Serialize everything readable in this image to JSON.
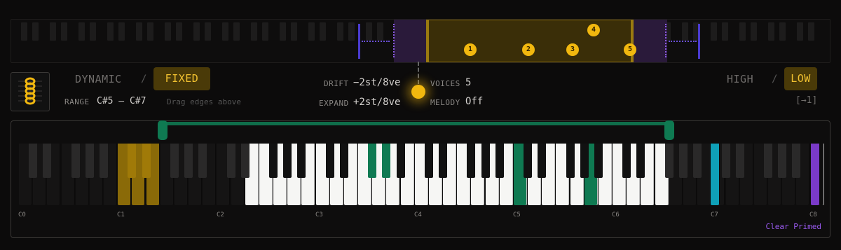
{
  "mode": {
    "dynamic": "DYNAMIC",
    "fixed": "FIXED",
    "separator": "/"
  },
  "range": {
    "label": "RANGE",
    "value": "C#5 – C#7",
    "hint": "Drag edges above"
  },
  "drift": {
    "label": "DRIFT",
    "value": "−2st/8ve"
  },
  "expand": {
    "label": "EXPAND",
    "value": "+2st/8ve"
  },
  "voices": {
    "label": "VOICES",
    "value": "5"
  },
  "melody": {
    "label": "MELODY",
    "value": "Off"
  },
  "priority": {
    "high": "HIGH",
    "low": "LOW",
    "separator": "/",
    "shortcut": "[→1]"
  },
  "voice_markers": [
    "1",
    "2",
    "3",
    "4",
    "5"
  ],
  "octave_labels": [
    "C0",
    "C1",
    "C2",
    "C3",
    "C4",
    "C5",
    "C6",
    "C7",
    "C8"
  ],
  "clear_label": "Clear Primed",
  "colors": {
    "accent": "#f2b80f",
    "range": "#0f7a52",
    "primed": "#7a3ac8",
    "cyan": "#0fa0b8"
  }
}
